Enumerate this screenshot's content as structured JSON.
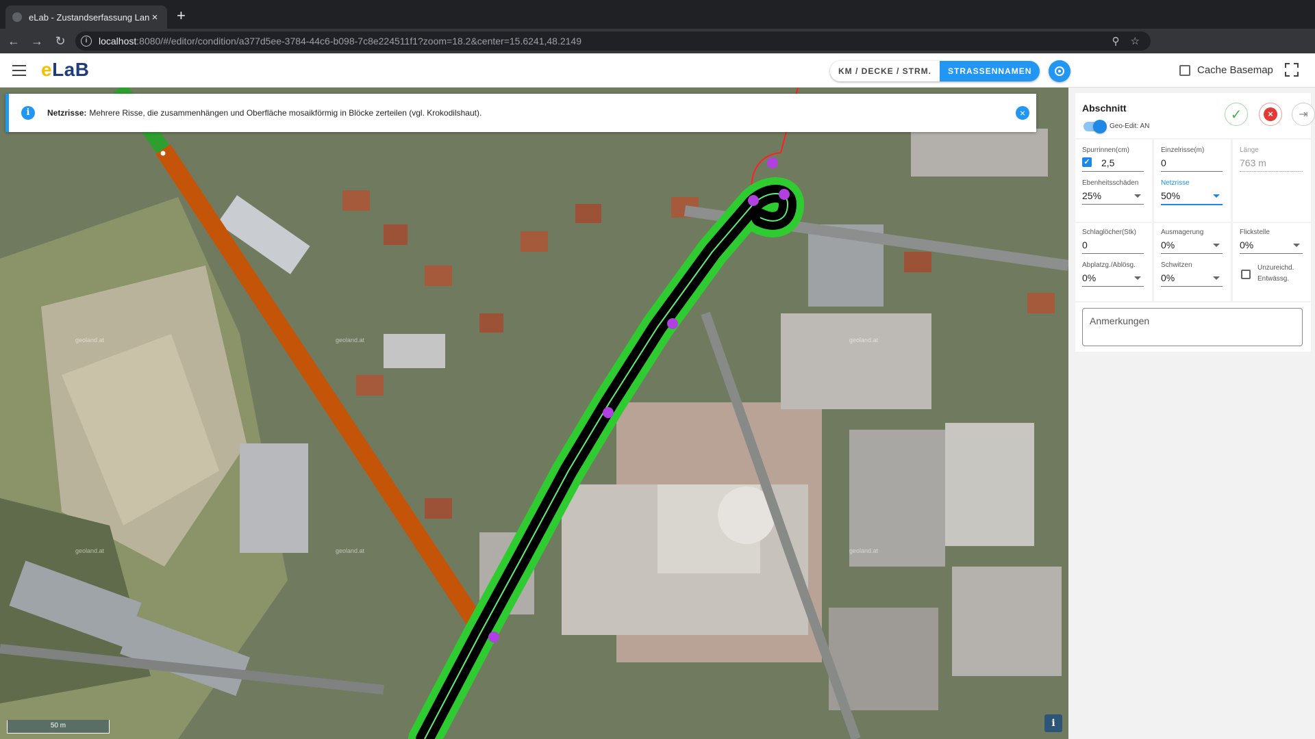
{
  "browser": {
    "tab_title": "eLab - Zustandserfassung Lan",
    "tab_close": "×",
    "new_tab": "+",
    "url_host": "localhost",
    "url_path": ":8080/#/editor/condition/a377d5ee-3784-44c6-b098-7c8e224511f1?zoom=18.2&center=15.6241,48.2149"
  },
  "header": {
    "logo_e": "e",
    "logo_rest": "LaB",
    "toggle_options": [
      "KM / DECKE / STRM.",
      "STRASSENNAMEN"
    ],
    "active_toggle": "STRASSENNAMEN",
    "cache_label": "Cache Basemap",
    "cache_checked": false
  },
  "alert": {
    "title": "Netzrisse:",
    "text": "Mehrere Risse, die zusammenhängen und Oberfläche mosaikförmig in Blöcke zerteilen (vgl. Krokodilshaut)."
  },
  "map": {
    "scale_label": "50 m",
    "info_label": "i",
    "watermark": "geoland.at",
    "colors": {
      "road_selected_outer": "#2ecc30",
      "road_selected_inner": "#000000",
      "road_selected_center": "#5ef07a",
      "road_other": "#cc5500",
      "road_green": "#2e9e2e",
      "vertex": "#b040e0",
      "red_line": "#ff2020"
    }
  },
  "panel": {
    "title": "Abschnitt",
    "geo_edit_label": "Geo-Edit: AN",
    "fields": {
      "spurrinnen": {
        "label": "Spurrinnen(cm)",
        "value": "2,5",
        "checked": true
      },
      "einzelrisse": {
        "label": "Einzelrisse(m)",
        "value": "0"
      },
      "laenge": {
        "label": "Länge",
        "value": "763 m"
      },
      "ebenheitsschaeden": {
        "label": "Ebenheitsschäden",
        "value": "25%"
      },
      "netzrisse": {
        "label": "Netzrisse",
        "value": "50%"
      },
      "schlagloecher": {
        "label": "Schlaglöcher(Stk)",
        "value": "0"
      },
      "ausmagerung": {
        "label": "Ausmagerung",
        "value": "0%"
      },
      "flickstelle": {
        "label": "Flickstelle",
        "value": "0%"
      },
      "abplatzg": {
        "label": "Abplatzg./Ablösg.",
        "value": "0%"
      },
      "schwitzen": {
        "label": "Schwitzen",
        "value": "0%"
      },
      "unzureichd_line1": "Unzureichd.",
      "unzureichd_line2": "Entwässg.",
      "unzureichd_checked": false
    },
    "remarks_placeholder": "Anmerkungen"
  }
}
